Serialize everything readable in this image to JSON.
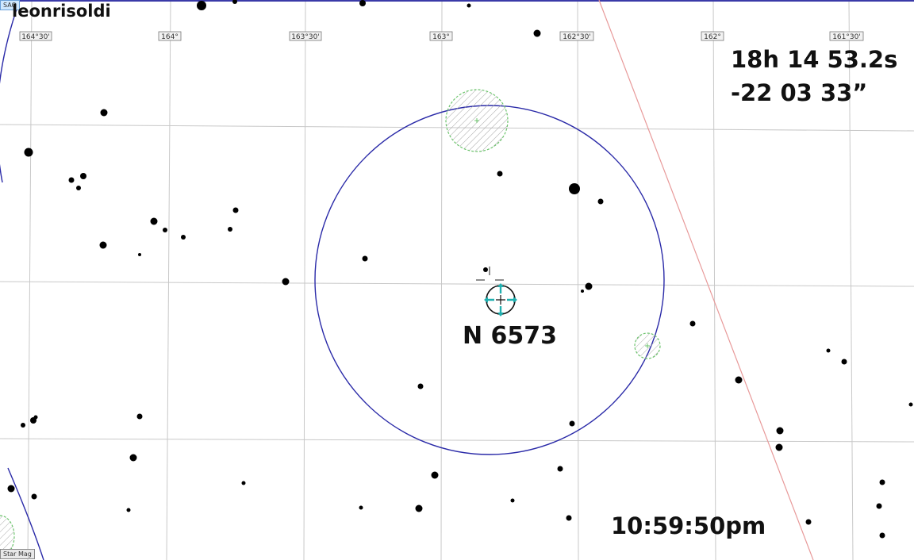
{
  "header": {
    "author": "leonrisoldi",
    "corner_tag": "SAO"
  },
  "coordinates": {
    "ra": "18h 14 53.2s",
    "dec": "-22 03 33”"
  },
  "target": {
    "label": "N 6573"
  },
  "footer": {
    "time": "10:59:50pm",
    "app_tag": "Star Mag"
  },
  "grid": {
    "ra_tick_labels": [
      "164°30'",
      "164°",
      "163°30'",
      "163°",
      "162°30'",
      "162°",
      "161°30'"
    ]
  },
  "colors": {
    "background": "#ffffff",
    "grid": "#c8c8c8",
    "fov_circle": "#2a2aa8",
    "ecliptic_line": "#e89a9a",
    "galaxy": "#6cc46c",
    "target_marker": "#20b0b0",
    "stars": "#000000"
  },
  "icons": {
    "target_marker": "telescope-reticle-icon",
    "cursor": "crosshair-cursor-icon"
  }
}
